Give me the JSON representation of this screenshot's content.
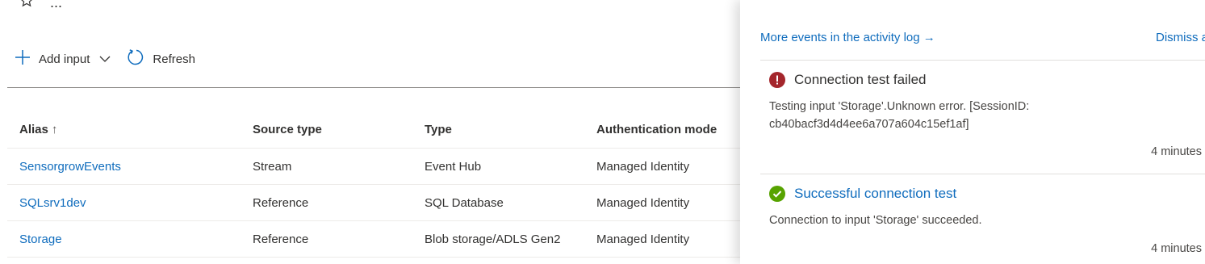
{
  "header": {
    "icons": [
      "star-icon",
      "more-icon"
    ],
    "more_glyph": "..."
  },
  "toolbar": {
    "add_input_label": "Add input",
    "refresh_label": "Refresh"
  },
  "table": {
    "columns": [
      "Alias",
      "Source type",
      "Type",
      "Authentication mode"
    ],
    "sort_indicator": "↑",
    "rows": [
      {
        "alias": "SensorgrowEvents",
        "source_type": "Stream",
        "type": "Event Hub",
        "auth": "Managed Identity"
      },
      {
        "alias": "SQLsrv1dev",
        "source_type": "Reference",
        "type": "SQL Database",
        "auth": "Managed Identity"
      },
      {
        "alias": "Storage",
        "source_type": "Reference",
        "type": "Blob storage/ADLS Gen2",
        "auth": "Managed Identity"
      }
    ]
  },
  "panel": {
    "more_events_label": "More events in the activity log →",
    "dismiss_label": "Dismiss a",
    "notifications": [
      {
        "status": "error",
        "title": "Connection test failed",
        "body": "Testing input 'Storage'.Unknown error. [SessionID: cb40bacf3d4d4ee6a707a604c15ef1af]",
        "time": "4 minutes"
      },
      {
        "status": "success",
        "title": "Successful connection test",
        "body": "Connection to input 'Storage' succeeded.",
        "time": "4 minutes"
      }
    ]
  },
  "colors": {
    "link": "#0f6cbd",
    "error": "#a4262c",
    "success": "#57a300"
  }
}
